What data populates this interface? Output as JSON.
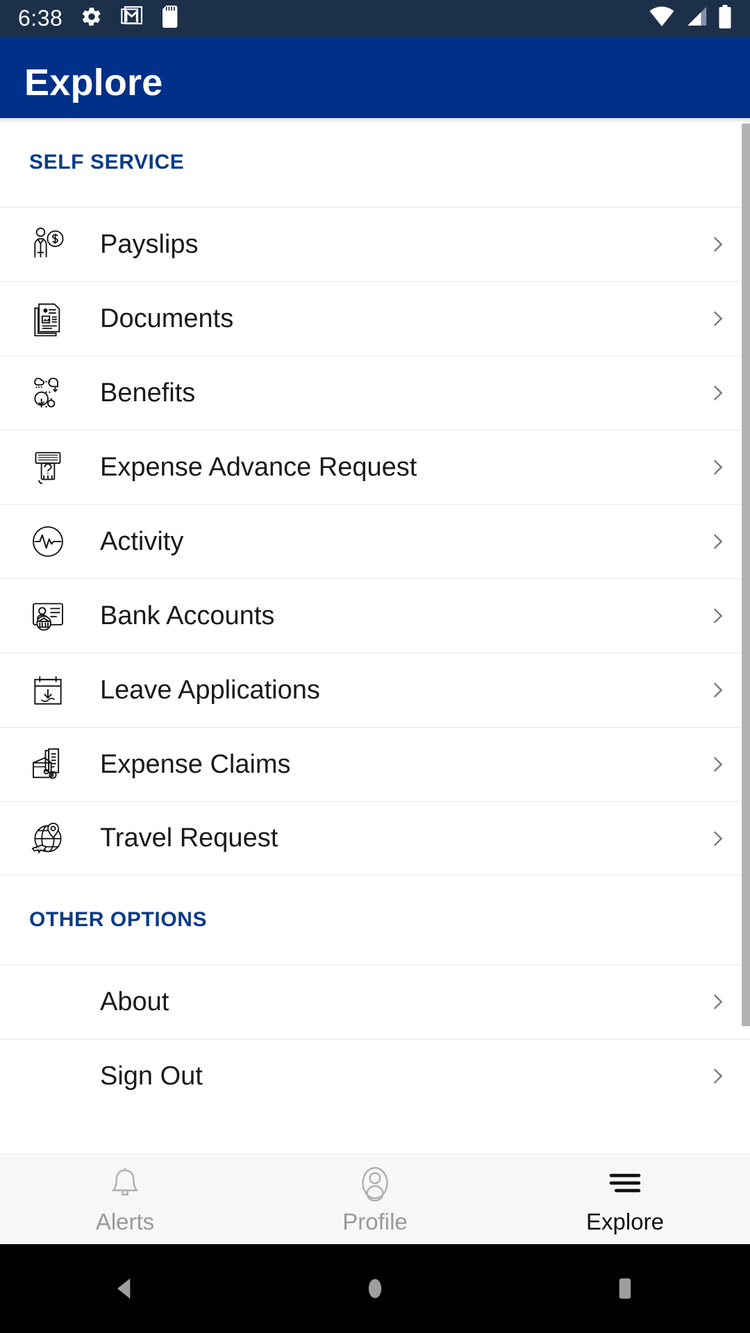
{
  "status_bar": {
    "time": "6:38",
    "left_icons": [
      "gear-icon",
      "gmail-icon",
      "sd-card-icon"
    ],
    "right_icons": [
      "wifi-icon",
      "cellular-signal-icon",
      "battery-icon"
    ],
    "background_color": "#1d3049"
  },
  "app_bar": {
    "title": "Explore",
    "background_color": "#003087",
    "text_color": "#ffffff"
  },
  "sections": [
    {
      "header": "SELF SERVICE",
      "header_color": "#0c3b87",
      "items": [
        {
          "label": "Payslips",
          "icon": "payslip-person-money-icon"
        },
        {
          "label": "Documents",
          "icon": "documents-stack-icon"
        },
        {
          "label": "Benefits",
          "icon": "benefits-tree-icon"
        },
        {
          "label": "Expense Advance Request",
          "icon": "cash-dispenser-icon"
        },
        {
          "label": "Activity",
          "icon": "activity-pulse-icon"
        },
        {
          "label": "Bank Accounts",
          "icon": "bank-card-icon"
        },
        {
          "label": "Leave Applications",
          "icon": "calendar-download-icon"
        },
        {
          "label": "Expense Claims",
          "icon": "wallet-receipt-icon"
        },
        {
          "label": "Travel Request",
          "icon": "globe-plane-icon"
        }
      ]
    },
    {
      "header": "OTHER OPTIONS",
      "header_color": "#0c3b87",
      "items": [
        {
          "label": "About",
          "icon": ""
        },
        {
          "label": "Sign Out",
          "icon": ""
        }
      ]
    }
  ],
  "bottom_nav": {
    "items": [
      {
        "label": "Alerts",
        "icon": "bell-icon",
        "active": false
      },
      {
        "label": "Profile",
        "icon": "person-icon",
        "active": false
      },
      {
        "label": "Explore",
        "icon": "hamburger-icon",
        "active": true
      }
    ],
    "inactive_color": "#9a9a9a",
    "active_color": "#111111",
    "background_color": "#f6f7f8"
  },
  "android_nav": {
    "buttons": [
      "back-button",
      "home-button",
      "recents-button"
    ],
    "background_color": "#000000",
    "icon_color": "#9e9e9e"
  }
}
